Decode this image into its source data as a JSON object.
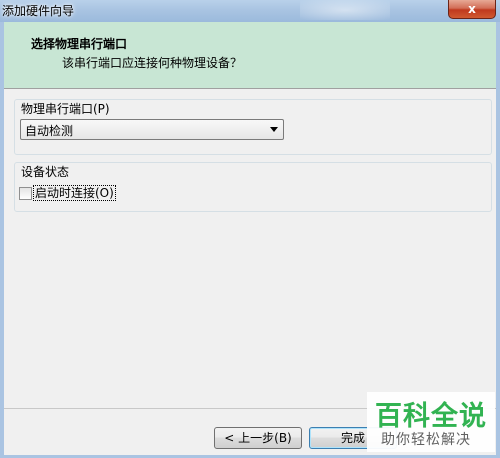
{
  "window": {
    "title": "添加硬件向导",
    "close_label": "x"
  },
  "header": {
    "title": "选择物理串行端口",
    "subtitle": "该串行端口应连接何种物理设备？"
  },
  "port_group": {
    "legend": "物理串行端口(P)",
    "select_value": "自动检测"
  },
  "status_group": {
    "legend": "设备状态",
    "checkbox_label": "启动时连接(O)",
    "checked": false
  },
  "footer": {
    "back_label": "< 上一步(B)",
    "finish_label": "完成"
  },
  "watermark": {
    "main": "百科全说",
    "sub": "助你轻松解决"
  },
  "colors": {
    "header_bg": "#c8e6d4",
    "titlebar": "#a9c4e2",
    "close": "#c0391e",
    "watermark_green": "#28b04a"
  }
}
